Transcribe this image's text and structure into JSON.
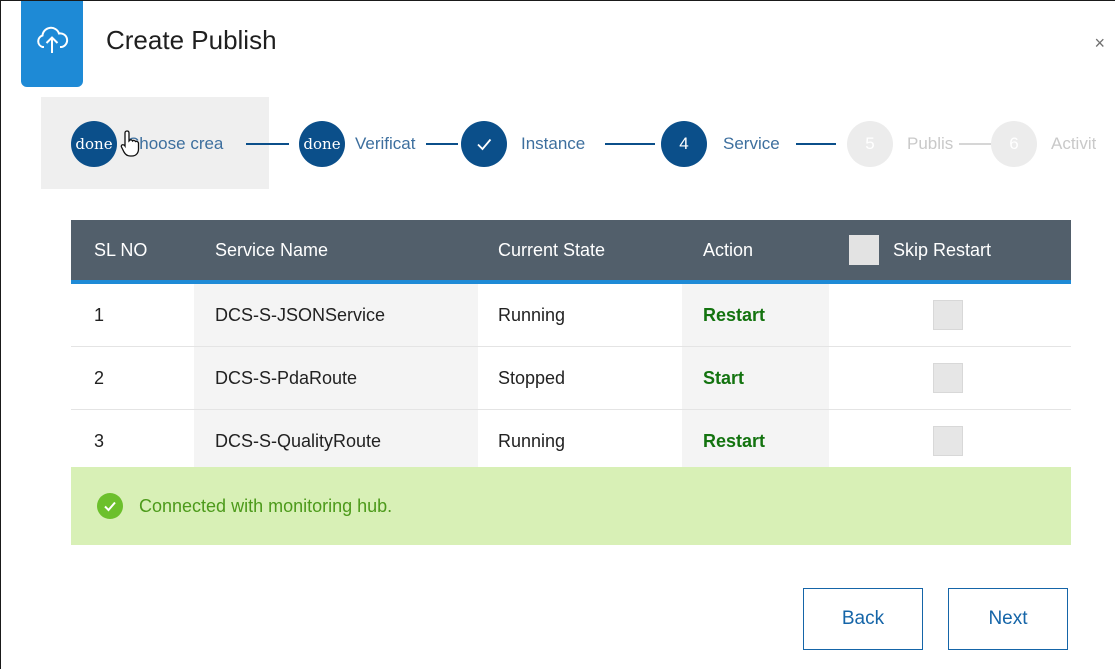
{
  "dialog": {
    "title": "Create Publish",
    "close_glyph": "×"
  },
  "stepper": {
    "steps": [
      {
        "badge": "done",
        "label": "Choose crea",
        "state": "done"
      },
      {
        "badge": "done",
        "label": "Verificat",
        "state": "done"
      },
      {
        "badge": "✓",
        "label": "Instance",
        "state": "complete"
      },
      {
        "badge": "4",
        "label": "Service",
        "state": "active"
      },
      {
        "badge": "5",
        "label": "Publis",
        "state": "pending"
      },
      {
        "badge": "6",
        "label": "Activit",
        "state": "pending"
      }
    ]
  },
  "table": {
    "headers": [
      "SL NO",
      "Service Name",
      "Current State",
      "Action",
      "Skip Restart"
    ],
    "rows": [
      {
        "sl": "1",
        "name": "DCS-S-JSONService",
        "state": "Running",
        "action": "Restart"
      },
      {
        "sl": "2",
        "name": "DCS-S-PdaRoute",
        "state": "Stopped",
        "action": "Start"
      },
      {
        "sl": "3",
        "name": "DCS-S-QualityRoute",
        "state": "Running",
        "action": "Restart"
      }
    ]
  },
  "status": {
    "message": "Connected with monitoring hub."
  },
  "buttons": {
    "back": "Back",
    "next": "Next"
  },
  "colors": {
    "primary": "#0b4f8a",
    "accent": "#1e8ad6",
    "header_bg": "#525f6b",
    "action_green": "#13730f",
    "success_bg": "#d8f0b6",
    "success_text": "#4c9a1a"
  },
  "icons": {
    "app": "cloud-upload-icon",
    "close": "close-icon",
    "success": "check-circle-icon",
    "cursor": "hand-pointer-icon"
  }
}
